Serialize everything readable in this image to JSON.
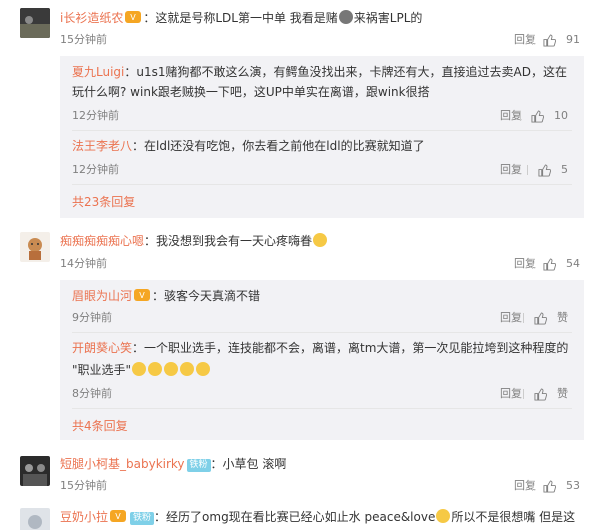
{
  "comments": [
    {
      "name": "i长衫造纸农",
      "text": "：这就是号称LDL第一中单 我看是赌",
      "text_tail": "来祸害LPL的",
      "time": "15分钟前",
      "reply": "回复",
      "likes": "91"
    },
    {
      "name": "痴痴痴痴痴心嗯",
      "text": "：我没想到我会有一天心疼嗨眷",
      "time": "14分钟前",
      "reply": "回复",
      "likes": "54"
    },
    {
      "name": "短腿小柯基_babykirky",
      "fan_badge": "铁粉",
      "text": "：小草包 滚啊",
      "time": "15分钟前",
      "reply": "回复",
      "likes": "53"
    },
    {
      "name": "豆奶小拉",
      "fan_badge": "铁粉",
      "text": "：经历了omg现在看比赛已经心如止水 peace&love",
      "text_tail": "所以不是很想嘴 但是这"
    }
  ],
  "thread1": {
    "replies": [
      {
        "name": "夏九Luigi",
        "line1": "：u1s1赌狗都不敢这么演，有鳄鱼没找出来，卡牌还有大，直接追过去卖AD，这在",
        "line2": "玩什么啊? wink跟老贼换一下吧，这UP中单实在离谱，跟wink很搭",
        "time": "12分钟前",
        "reply": "回复",
        "likes": "10"
      },
      {
        "name": "法王李老八",
        "line1": "：在ldl还没有吃饱，你去看之前他在ldl的比赛就知道了",
        "time": "12分钟前",
        "reply": "回复",
        "likes": "5"
      }
    ],
    "more": "共23条回复"
  },
  "thread2": {
    "replies": [
      {
        "name": "眉眼为山河",
        "line1": "：骇客今天真滴不错",
        "time": "9分钟前",
        "reply": "回复",
        "likes": "赞"
      },
      {
        "name": "开朗葵心笑",
        "line1": "：一个职业选手，连技能都不会，离谱，离tm大谱，第一次见能拉垮到这种程度的",
        "line2": "\"职业选手\"",
        "time": "8分钟前",
        "reply": "回复",
        "likes": "赞"
      }
    ],
    "more": "共4条回复"
  },
  "icons": {
    "like": "thumbs-up-icon"
  },
  "colors": {
    "name": "#eb7350",
    "meta": "#808080",
    "subbg": "#f2f2f5"
  }
}
